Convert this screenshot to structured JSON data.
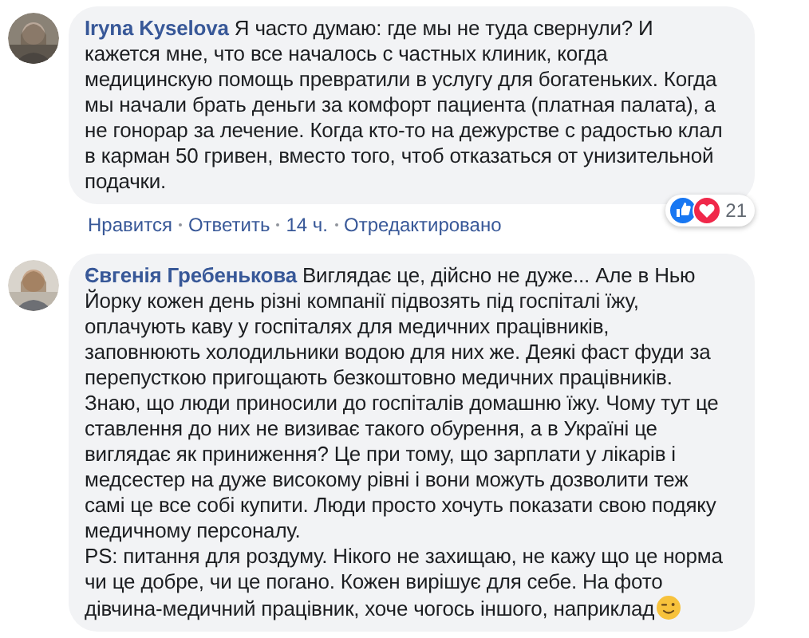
{
  "comments": [
    {
      "author": "Iryna Kyselova",
      "text": "Я часто думаю: где мы не туда свернули? И кажется мне, что все началось с частных клиник, когда медицинскую помощь превратили в услугу для богатеньких. Когда мы начали брать деньги за комфорт пациента (платная палата), а не гонорар за лечение. Когда кто-то на дежурстве с радостью клал в карман 50 гривен, вместо того, чтоб отказаться от унизительной подачки.",
      "ends_with_emoji": false,
      "actions": [
        "Нравится",
        "Ответить"
      ],
      "time": "14 ч.",
      "edited_label": "Отредактировано",
      "reactions": {
        "like": true,
        "love": true,
        "count": "21"
      }
    },
    {
      "author": "Євгенія Гребенькова",
      "text": "Виглядає це, дійсно не дуже... Але в Нью Йорку кожен день різні компанії підвозять під госпіталі їжу, оплачують каву у госпіталях для медичних працівників, заповнюють холодильники водою для них же. Деякі фаст фуди за перепусткою пригощають безкоштовно медичних працівників. Знаю, що люди приносили до госпіталів домашню їжу. Чому тут це ставлення до них не визиває такого обурення, а в Україні це виглядає як приниження? Це при тому, що зарплати у лікарів і медсестер на дуже високому рівні і вони можуть дозволити теж самі це все собі купити. Люди просто хочуть показати свою подяку медичному персоналу.\nPS: питання для роздуму. Нікого не захищаю, не кажу що це норма чи це добре, чи це погано. Кожен вирішує для себе. На фото дівчина-медичний працівник, хоче чогось іншого, наприклад",
      "ends_with_emoji": true
    }
  ]
}
